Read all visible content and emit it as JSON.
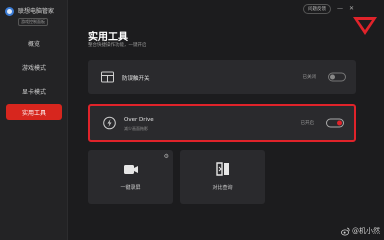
{
  "app": {
    "title": "联想电脑管家",
    "subtitle": "游戏控制面板"
  },
  "topbar": {
    "feedback_label": "问题反馈",
    "minimize": "—",
    "close": "✕"
  },
  "sidebar": {
    "items": [
      {
        "label": "概览"
      },
      {
        "label": "游戏模式"
      },
      {
        "label": "显卡模式"
      },
      {
        "label": "实用工具"
      }
    ]
  },
  "main": {
    "title": "实用工具",
    "description": "整合快捷操作功能，一键开启",
    "rows": [
      {
        "label": "防误触开关",
        "status": "已关闭",
        "enabled": false,
        "icon": "keyboard-icon"
      },
      {
        "label": "Over Drive",
        "sublabel": "减少画面拖影",
        "status": "已开启",
        "enabled": true,
        "icon": "overdrive-icon"
      }
    ],
    "tiles": [
      {
        "label": "一键录屏",
        "icon": "camera-icon"
      },
      {
        "label": "对比查询",
        "icon": "compare-icon"
      }
    ]
  },
  "watermark": {
    "text": "@机小然"
  },
  "colors": {
    "accent": "#e0232a",
    "background": "#1c1c1e",
    "card": "#2a2a2d"
  }
}
